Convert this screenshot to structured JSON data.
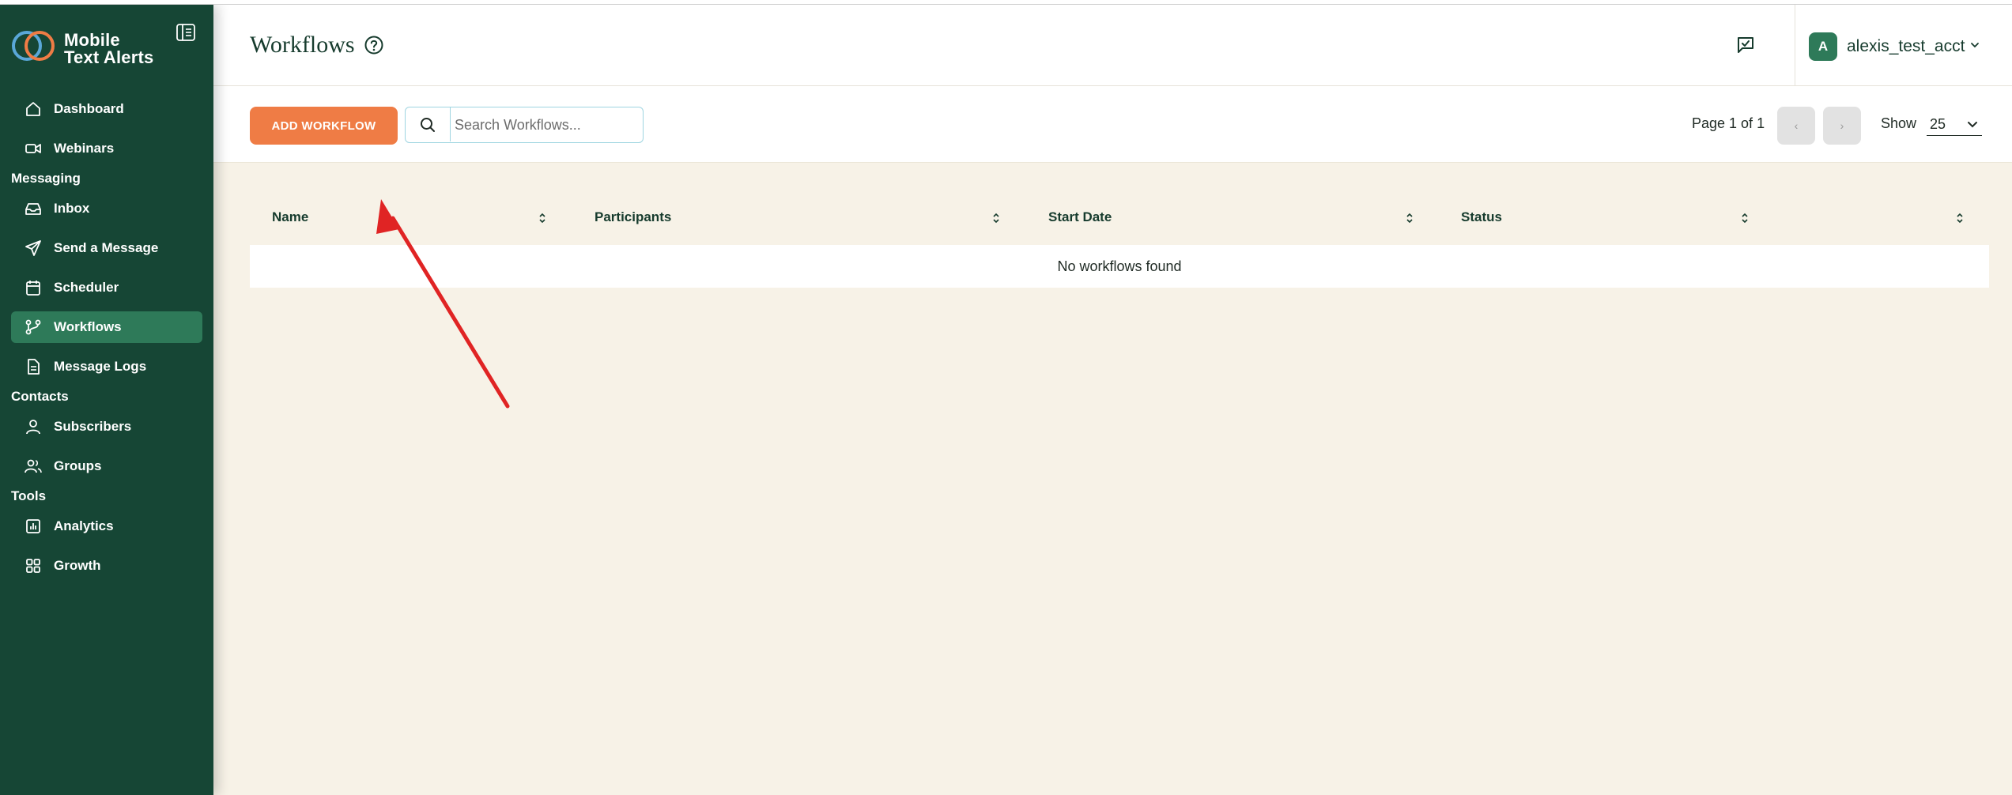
{
  "app": {
    "logo_text_line1": "Mobile",
    "logo_text_line2": "Text Alerts"
  },
  "sidebar": {
    "items_top": [
      {
        "label": "Dashboard",
        "icon": "home-icon"
      },
      {
        "label": "Webinars",
        "icon": "video-icon"
      }
    ],
    "sections": [
      {
        "label": "Messaging",
        "items": [
          {
            "label": "Inbox",
            "icon": "inbox-icon"
          },
          {
            "label": "Send a Message",
            "icon": "send-icon"
          },
          {
            "label": "Scheduler",
            "icon": "calendar-icon"
          },
          {
            "label": "Workflows",
            "icon": "workflow-icon",
            "active": true
          },
          {
            "label": "Message Logs",
            "icon": "document-icon"
          }
        ]
      },
      {
        "label": "Contacts",
        "items": [
          {
            "label": "Subscribers",
            "icon": "user-icon"
          },
          {
            "label": "Groups",
            "icon": "users-icon"
          }
        ]
      },
      {
        "label": "Tools",
        "items": [
          {
            "label": "Analytics",
            "icon": "chart-icon"
          },
          {
            "label": "Growth",
            "icon": "grid-icon"
          }
        ]
      }
    ]
  },
  "header": {
    "title": "Workflows",
    "account_initial": "A",
    "account_name": "alexis_test_acct"
  },
  "toolbar": {
    "add_label": "ADD WORKFLOW",
    "search_placeholder": "Search Workflows...",
    "page_info": "Page 1 of 1",
    "prev_glyph": "‹",
    "next_glyph": "›",
    "show_label": "Show",
    "show_value": "25"
  },
  "table": {
    "columns": [
      "Name",
      "Participants",
      "Start Date",
      "Status",
      ""
    ],
    "empty_message": "No workflows found"
  },
  "colors": {
    "sidebar_bg": "#164635",
    "active_item": "#2e7a59",
    "accent_orange": "#ef7c45",
    "content_bg": "#f7f2e7",
    "annotation_arrow": "#e02424"
  }
}
